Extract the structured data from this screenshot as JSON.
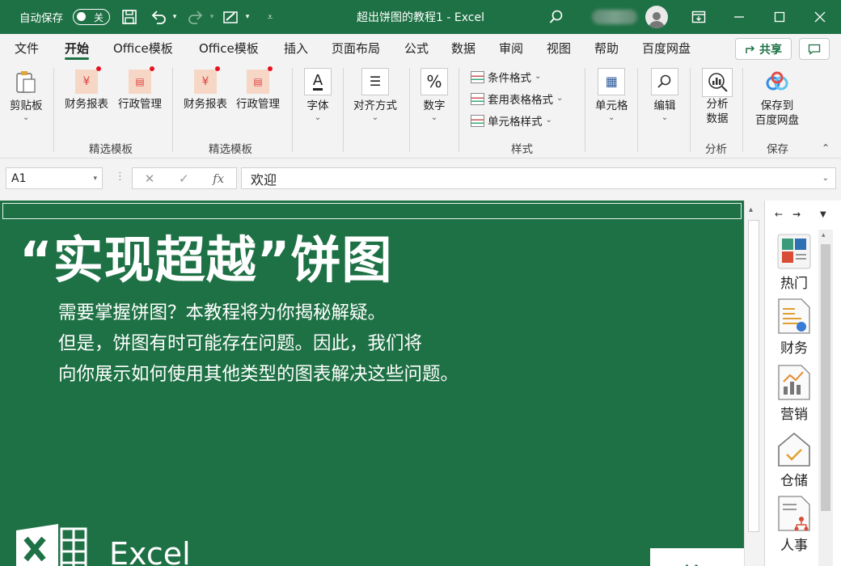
{
  "titlebar": {
    "autosave_label": "自动保存",
    "autosave_state": "关",
    "title": "超出饼图的教程1 - Excel"
  },
  "tabs": [
    "文件",
    "开始",
    "Office模板",
    "Office模板",
    "插入",
    "页面布局",
    "公式",
    "数据",
    "审阅",
    "视图",
    "帮助",
    "百度网盘"
  ],
  "share_label": "共享",
  "ribbon": {
    "clipboard": "剪贴板",
    "finance1": "财务报表",
    "admin1": "行政管理",
    "group_templates1": "精选模板",
    "finance2": "财务报表",
    "admin2": "行政管理",
    "group_templates2": "精选模板",
    "font": "字体",
    "align": "对齐方式",
    "number": "数字",
    "cond_format": "条件格式",
    "table_format": "套用表格格式",
    "cell_style": "单元格样式",
    "group_style": "样式",
    "cells": "单元格",
    "edit": "编辑",
    "analyze_line1": "分析",
    "analyze_line2": "数据",
    "group_analyze": "分析",
    "save_line1": "保存到",
    "save_line2": "百度网盘",
    "group_save": "保存"
  },
  "formula_bar": {
    "name_box": "A1",
    "fx_symbol": "fx",
    "content": "欢迎"
  },
  "sheet": {
    "headline": "“实现超越”饼图",
    "line1": "需要掌握饼图？本教程将为你揭秘解疑。",
    "line2": "但是，饼图有时可能存在问题。因此，我们将",
    "line3": "向你展示如何使用其他类型的图表解决这些问题。",
    "logo_text": "Excel",
    "start_button": "开始吧"
  },
  "pane": {
    "items": [
      "热门",
      "财务",
      "营销",
      "仓储",
      "人事"
    ]
  },
  "colors": {
    "excel_green": "#1e7145",
    "ribbon_bg": "#f3f3f3"
  }
}
